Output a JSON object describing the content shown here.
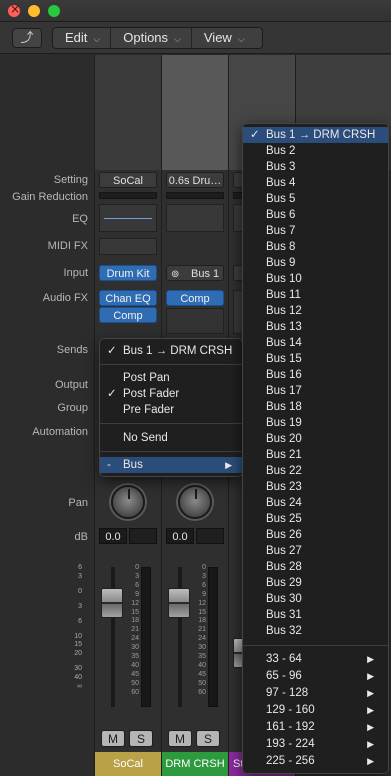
{
  "toolbar": {
    "back_glyph": "⤴",
    "menus": [
      {
        "label": "Edit"
      },
      {
        "label": "Options"
      },
      {
        "label": "View"
      }
    ]
  },
  "row_labels": {
    "setting": "Setting",
    "gain_reduction": "Gain Reduction",
    "eq": "EQ",
    "midi_fx": "MIDI FX",
    "input": "Input",
    "audio_fx": "Audio FX",
    "sends": "Sends",
    "output": "Output",
    "group": "Group",
    "automation": "Automation",
    "pan": "Pan",
    "db": "dB"
  },
  "strips": [
    {
      "setting": "SoCal",
      "input": "Drum Kit",
      "audio_fx": [
        "Chan EQ",
        "Comp"
      ],
      "db": "0.0",
      "mute": "M",
      "solo": "S",
      "name": "SoCal",
      "color": "#b8a146"
    },
    {
      "setting": "0.6s Dru…",
      "input_icon": "link-icon",
      "input": "Bus 1",
      "audio_fx": [
        "Comp"
      ],
      "db": "0.0",
      "mute": "M",
      "solo": "S",
      "name": "DRM CRSH",
      "color": "#2e9a3e"
    },
    {
      "name_partial": "St",
      "color": "#8a2aa0"
    }
  ],
  "fader_scale": [
    "6",
    "3",
    "0",
    "3",
    "6",
    "10",
    "15",
    "20",
    "30",
    "40",
    "∞"
  ],
  "meter_scale": [
    "0",
    "3",
    "6",
    "9",
    "12",
    "15",
    "18",
    "21",
    "24",
    "30",
    "35",
    "40",
    "45",
    "50",
    "60"
  ],
  "sends_menu": {
    "current": "Bus 1 → DRM CRSH",
    "items": [
      "Post Pan",
      "Post Fader",
      "Pre Fader"
    ],
    "checked_item": "Post Fader",
    "no_send": "No Send",
    "bus_prefix": "-",
    "bus_label": "Bus",
    "check_glyph": "✓",
    "arrow_glyph": "▶"
  },
  "bus_menu": {
    "items": [
      "Bus 1 → DRM CRSH",
      "Bus 2",
      "Bus 3",
      "Bus 4",
      "Bus 5",
      "Bus 6",
      "Bus 7",
      "Bus 8",
      "Bus 9",
      "Bus 10",
      "Bus 11",
      "Bus 12",
      "Bus 13",
      "Bus 14",
      "Bus 15",
      "Bus 16",
      "Bus 17",
      "Bus 18",
      "Bus 19",
      "Bus 20",
      "Bus 21",
      "Bus 22",
      "Bus 23",
      "Bus 24",
      "Bus 25",
      "Bus 26",
      "Bus 27",
      "Bus 28",
      "Bus 29",
      "Bus 30",
      "Bus 31",
      "Bus 32"
    ],
    "ranges": [
      "33 - 64",
      "65 - 96",
      "97 - 128",
      "129 - 160",
      "161 - 192",
      "193 - 224",
      "225 - 256"
    ]
  },
  "colors": {
    "highlight": "#2b4d7b",
    "blue_slot": "#2e6cb4"
  }
}
